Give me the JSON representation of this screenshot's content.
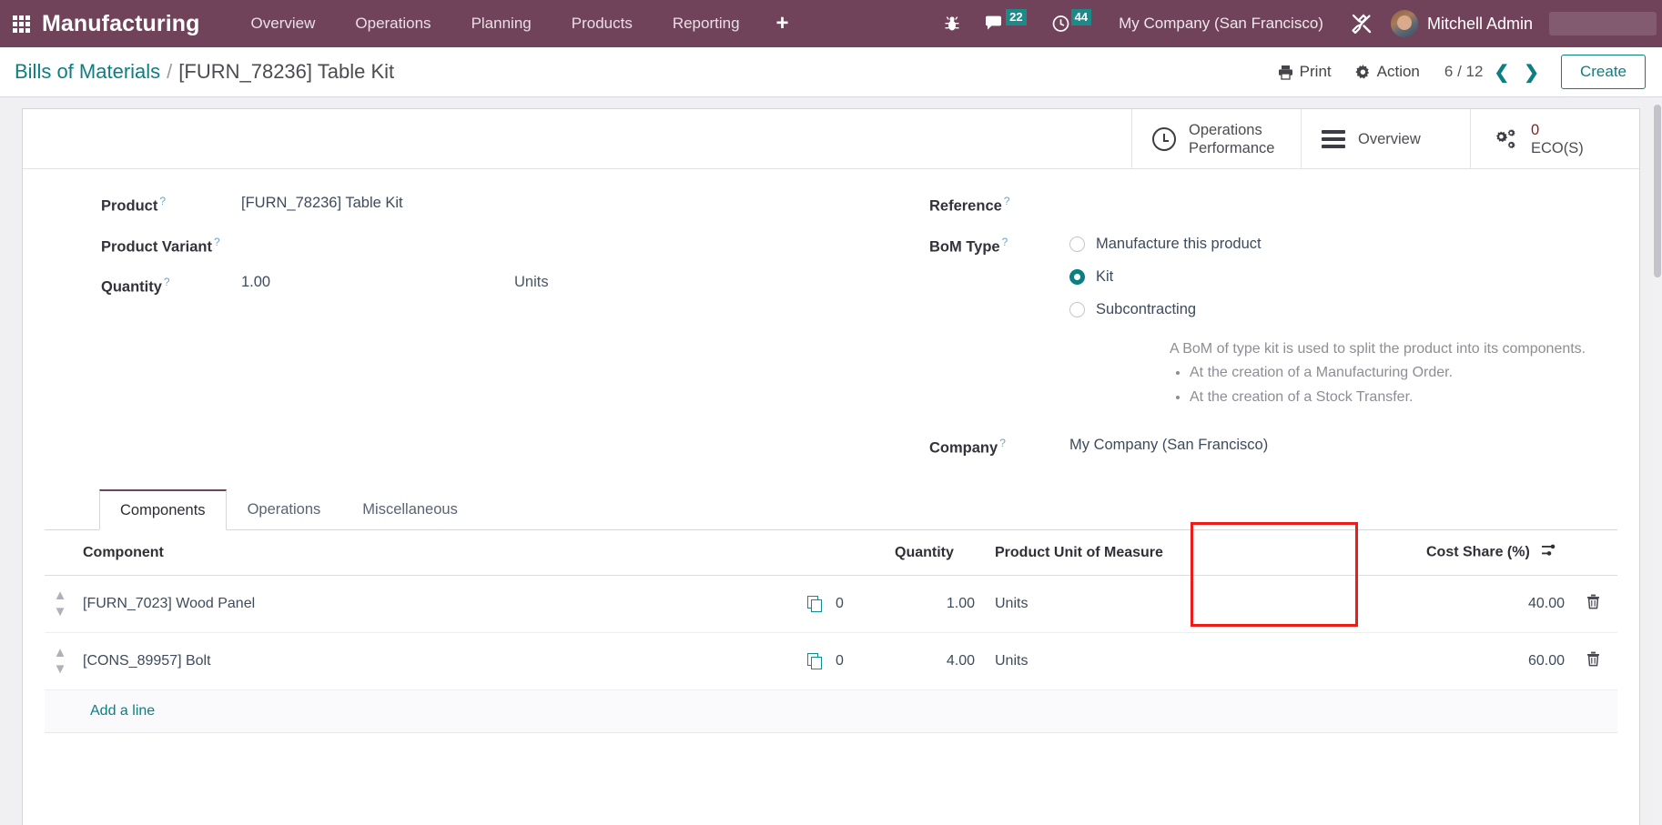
{
  "navbar": {
    "apps_icon": "grid-apps-icon",
    "brand": "Manufacturing",
    "menu": [
      {
        "label": "Overview"
      },
      {
        "label": "Operations"
      },
      {
        "label": "Planning"
      },
      {
        "label": "Products"
      },
      {
        "label": "Reporting"
      }
    ],
    "plus_label": "+",
    "bug_icon": "bug-icon",
    "messages_icon": "chat-bubble-icon",
    "messages_count": "22",
    "activities_icon": "clock-icon",
    "activities_count": "44",
    "company": "My Company (San Francisco)",
    "tools_icon": "wrench-screwdriver-icon",
    "user_name": "Mitchell Admin",
    "accent_color": "#71435b",
    "badge_color": "#1d8a8a"
  },
  "control_panel": {
    "breadcrumb_root": "Bills of Materials",
    "breadcrumb_separator": "/",
    "breadcrumb_current": "[FURN_78236] Table Kit",
    "print_label": "Print",
    "print_icon": "printer-icon",
    "action_label": "Action",
    "action_icon": "gear-icon",
    "pager": "6 / 12",
    "prev_icon": "chevron-left-icon",
    "next_icon": "chevron-right-icon",
    "create_label": "Create"
  },
  "stat_buttons": [
    {
      "icon": "clock-icon",
      "line1": "Operations",
      "line2": "Performance"
    },
    {
      "icon": "bars-icon",
      "line1": "Overview",
      "line2": ""
    },
    {
      "icon": "gears-icon",
      "value": "0",
      "line2": "ECO(S)"
    }
  ],
  "form": {
    "left": {
      "product_label": "Product",
      "product_value": "[FURN_78236] Table Kit",
      "variant_label": "Product Variant",
      "variant_value": "",
      "quantity_label": "Quantity",
      "quantity_value": "1.00",
      "quantity_uom": "Units"
    },
    "right": {
      "reference_label": "Reference",
      "reference_value": "",
      "bom_type_label": "BoM Type",
      "bom_type_options": [
        {
          "label": "Manufacture this product",
          "selected": false
        },
        {
          "label": "Kit",
          "selected": true
        },
        {
          "label": "Subcontracting",
          "selected": false
        }
      ],
      "help_intro": "A BoM of type kit is used to split the product into its components.",
      "help_bullets": [
        "At the creation of a Manufacturing Order.",
        "At the creation of a Stock Transfer."
      ],
      "company_label": "Company",
      "company_value": "My Company (San Francisco)"
    },
    "help_marker": "?"
  },
  "notebook": {
    "tabs": [
      {
        "label": "Components",
        "active": true
      },
      {
        "label": "Operations",
        "active": false
      },
      {
        "label": "Miscellaneous",
        "active": false
      }
    ]
  },
  "components_table": {
    "headers": {
      "component": "Component",
      "quantity": "Quantity",
      "uom": "Product Unit of Measure",
      "cost_share": "Cost Share (%)",
      "optional_columns_icon": "sliders-icon"
    },
    "rows": [
      {
        "handle_icon": "drag-handle-icon",
        "component": "[FURN_7023] Wood Panel",
        "attachment_icon": "files-icon",
        "attachment_count": "0",
        "quantity": "1.00",
        "uom": "Units",
        "cost_share": "40.00",
        "delete_icon": "trash-icon"
      },
      {
        "handle_icon": "drag-handle-icon",
        "component": "[CONS_89957] Bolt",
        "attachment_icon": "files-icon",
        "attachment_count": "0",
        "quantity": "4.00",
        "uom": "Units",
        "cost_share": "60.00",
        "delete_icon": "trash-icon"
      }
    ],
    "add_line_label": "Add a line"
  },
  "annotation": {
    "highlight_color": "#ef1b1b",
    "highlight_target": "cost-share-column"
  }
}
